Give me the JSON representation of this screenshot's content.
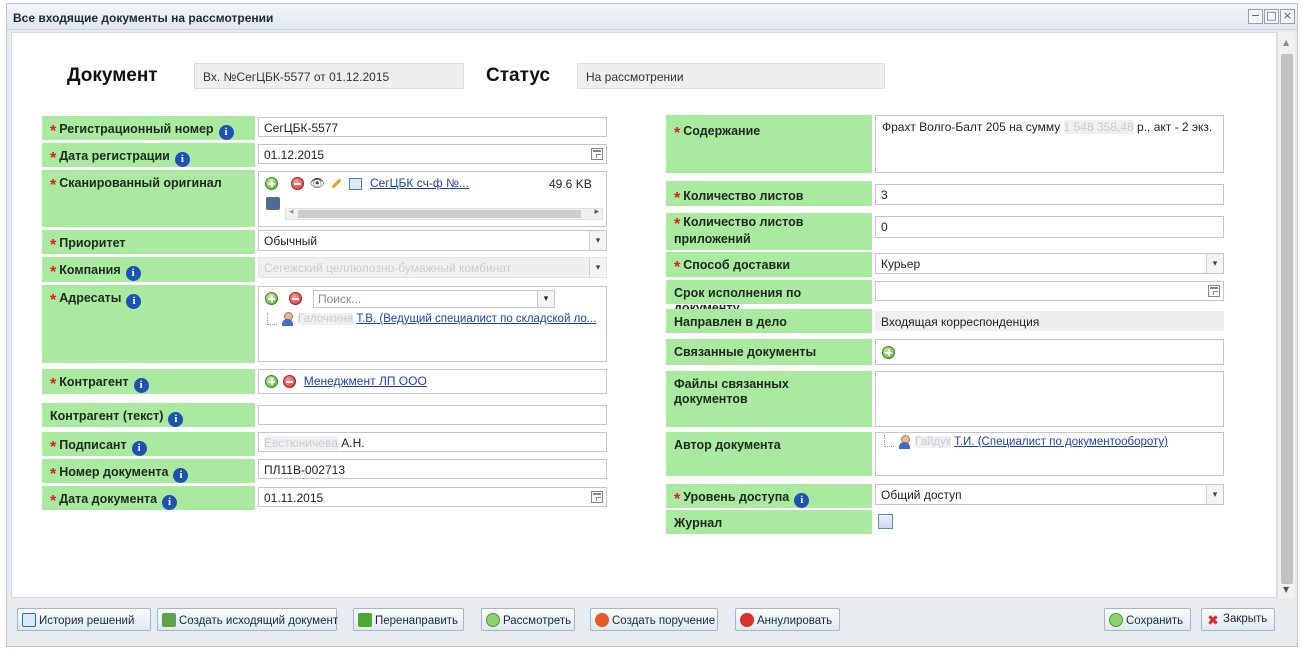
{
  "window": {
    "title": "Все входящие документы на рассмотрении",
    "ghost_title": "Все входящие документы на рассмотрении",
    "controls": [
      "−",
      "□",
      "×"
    ]
  },
  "header": {
    "doc_label": "Документ",
    "doc_value": "Вх. №СегЦБК-5577 от 01.12.2015",
    "status_label": "Статус",
    "status_value": "На рассмотрении"
  },
  "left": {
    "reg_number": {
      "label": "Регистрационный номер",
      "value": "СегЦБК-5577"
    },
    "reg_date": {
      "label": "Дата регистрации",
      "value": "01.12.2015"
    },
    "scan": {
      "label": "Сканированный оригинал",
      "file": "СегЦБК сч-ф №...",
      "size": "49.6 KB"
    },
    "priority": {
      "label": "Приоритет",
      "value": "Обычный"
    },
    "company": {
      "label": "Компания",
      "value": "Сегежский целлюлозно-бумажный комбинат"
    },
    "addressees": {
      "label": "Адресаты",
      "search_placeholder": "Поиск...",
      "person_name": "Галочкина",
      "person_rest": "Т.В. (Ведущий специалист по складской ло..."
    },
    "counterparty": {
      "label": "Контрагент",
      "value": "Менеджмент ЛП ООО"
    },
    "counterparty_text": {
      "label": "Контрагент (текст)",
      "value": ""
    },
    "signer": {
      "label": "Подписант",
      "name_hidden": "Евстюничева",
      "name_rest": "А.Н."
    },
    "doc_number": {
      "label": "Номер документа",
      "value": "ПЛ11В-002713"
    },
    "doc_date": {
      "label": "Дата документа",
      "value": "01.11.2015"
    }
  },
  "right": {
    "content": {
      "label": "Содержание",
      "value_start": "Фрахт Волго-Балт 205 на сумму",
      "value_hidden": "1 548 358,48",
      "value_end": "р., акт - 2 экз."
    },
    "sheets": {
      "label": "Количество листов",
      "value": "3"
    },
    "attach_sheets": {
      "label": "Количество листов приложений",
      "value": "0"
    },
    "delivery": {
      "label": "Способ доставки",
      "value": "Курьер"
    },
    "deadline": {
      "label": "Срок исполнения по документу",
      "value": ""
    },
    "case": {
      "label": "Направлен в дело",
      "value": "Входящая корреспонденция"
    },
    "related": {
      "label": "Связанные документы"
    },
    "related_files": {
      "label": "Файлы связанных документов"
    },
    "author": {
      "label": "Автор документа",
      "name_hidden": "Гайдук",
      "name_rest": "Т.И. (Специалист по документообороту)"
    },
    "access": {
      "label": "Уровень доступа",
      "value": "Общий доступ"
    },
    "journal": {
      "label": "Журнал"
    }
  },
  "buttons": {
    "history": "История решений",
    "create_outgoing": "Создать исходящий документ",
    "redirect": "Перенаправить",
    "review": "Рассмотреть",
    "create_task": "Создать поручение",
    "cancel": "Аннулировать",
    "save": "Сохранить",
    "close": "Закрыть"
  },
  "colors": {
    "label_bg": "#a9e9a0",
    "required": "#e01b1b",
    "info_icon": "#1c53b3",
    "link": "#1f3fb8"
  }
}
